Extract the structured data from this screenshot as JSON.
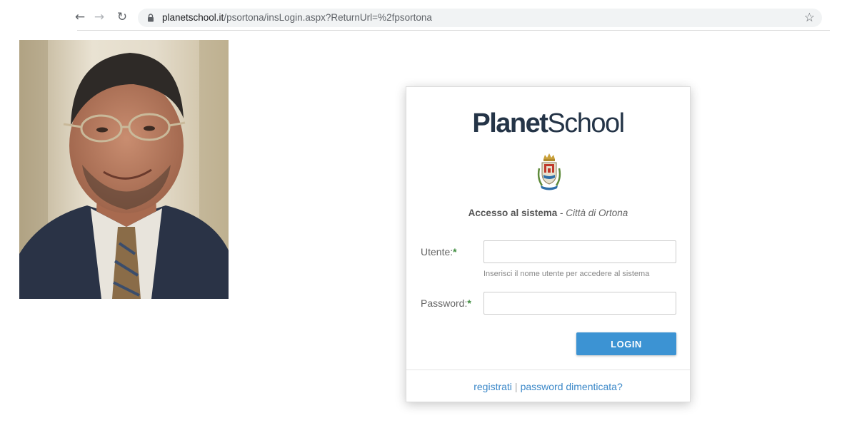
{
  "browser": {
    "back_label": "←",
    "forward_label": "→",
    "reload_label": "↻",
    "url_host": "planetschool.it",
    "url_path": "/psortona/insLogin.aspx?ReturnUrl=%2fpsortona",
    "bookmark_label": "☆"
  },
  "login": {
    "logo_bold": "Planet",
    "logo_light": "School",
    "subtitle_strong": "Accesso al sistema",
    "subtitle_sep": " - ",
    "subtitle_city": "Città di Ortona",
    "user_label": "Utente:",
    "password_label": "Password:",
    "required_mark": "*",
    "user_value": "",
    "password_value": "",
    "user_hint": "Inserisci il nome utente per accedere al sistema",
    "login_button": "LOGIN",
    "register_link": "registrati",
    "link_separator": "|",
    "forgot_link": "password dimenticata?"
  },
  "colors": {
    "button": "#3c93d3",
    "link": "#3a87c8",
    "logo": "#243447",
    "required": "#3d8b3d"
  },
  "icons": {
    "lock": "lock-icon",
    "star": "star-icon",
    "crest": "crest-icon"
  }
}
